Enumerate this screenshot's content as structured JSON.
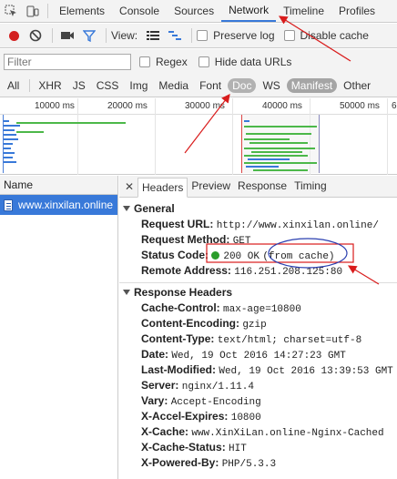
{
  "main_tabs": [
    "Elements",
    "Console",
    "Sources",
    "Network",
    "Timeline",
    "Profiles"
  ],
  "toolbar": {
    "view_label": "View:",
    "preserve_log": "Preserve log",
    "disable_cache": "Disable cache"
  },
  "filter": {
    "placeholder": "Filter",
    "regex": "Regex",
    "hide_data_urls": "Hide data URLs"
  },
  "types": [
    "All",
    "XHR",
    "JS",
    "CSS",
    "Img",
    "Media",
    "Font",
    "Doc",
    "WS",
    "Manifest",
    "Other"
  ],
  "overview": {
    "ticks": [
      "10000 ms",
      "20000 ms",
      "30000 ms",
      "40000 ms",
      "50000 ms",
      "6"
    ]
  },
  "list": {
    "header": "Name",
    "rows": [
      "www.xinxilan.online"
    ]
  },
  "detail_tabs": [
    "Headers",
    "Preview",
    "Response",
    "Timing"
  ],
  "general": {
    "title": "General",
    "request_url_k": "Request URL:",
    "request_url_v": "http://www.xinxilan.online/",
    "request_method_k": "Request Method:",
    "request_method_v": "GET",
    "status_code_k": "Status Code:",
    "status_code_v": "200 OK",
    "status_code_note": "(from cache)",
    "remote_address_k": "Remote Address:",
    "remote_address_v": "116.251.208.125:80"
  },
  "response_headers": {
    "title": "Response Headers",
    "items": [
      {
        "k": "Cache-Control:",
        "v": "max-age=10800"
      },
      {
        "k": "Content-Encoding:",
        "v": "gzip"
      },
      {
        "k": "Content-Type:",
        "v": "text/html; charset=utf-8"
      },
      {
        "k": "Date:",
        "v": "Wed, 19 Oct 2016 14:27:23 GMT"
      },
      {
        "k": "Last-Modified:",
        "v": "Wed, 19 Oct 2016 13:39:53 GMT"
      },
      {
        "k": "Server:",
        "v": "nginx/1.11.4"
      },
      {
        "k": "Vary:",
        "v": "Accept-Encoding"
      },
      {
        "k": "X-Accel-Expires:",
        "v": "10800"
      },
      {
        "k": "X-Cache:",
        "v": "www.XinXiLan.online-Nginx-Cached"
      },
      {
        "k": "X-Cache-Status:",
        "v": "HIT"
      },
      {
        "k": "X-Powered-By:",
        "v": "PHP/5.3.3"
      }
    ]
  },
  "colors": {
    "accent": "#3879d9",
    "record": "#d32020",
    "annotation_red": "#d91c1c",
    "annotation_blue": "#2a3fb0"
  }
}
